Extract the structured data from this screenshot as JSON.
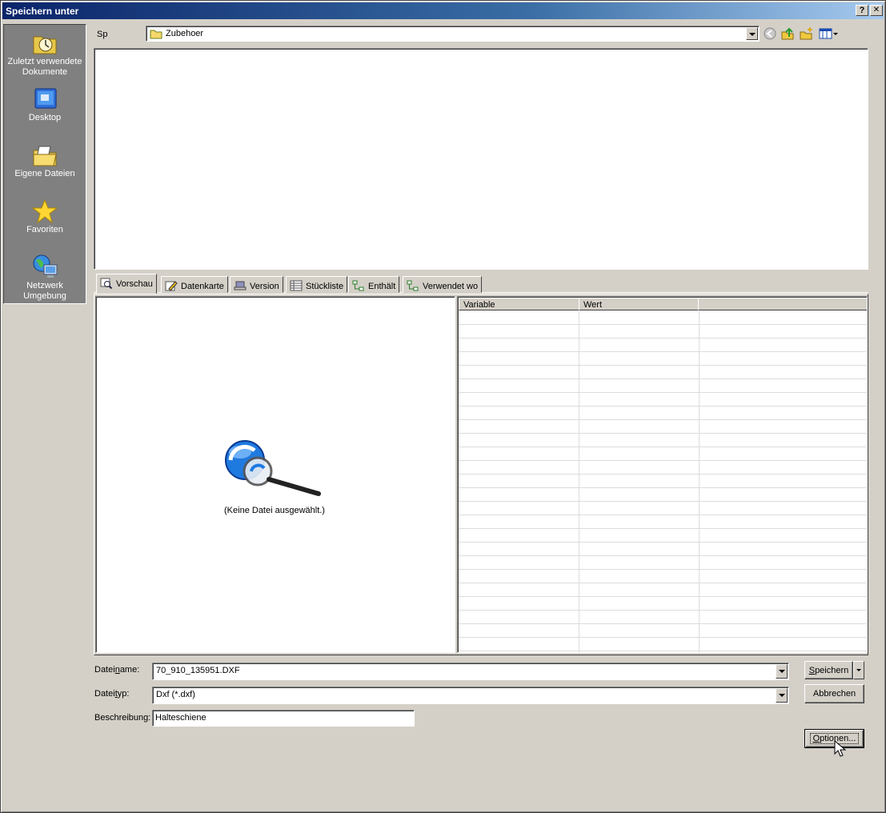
{
  "window": {
    "title": "Speichern unter",
    "help_label": "?",
    "close_label": "✕"
  },
  "places": [
    {
      "label": "Zuletzt verwendete Dokumente",
      "icon": "recent-documents-icon"
    },
    {
      "label": "Desktop",
      "icon": "desktop-icon"
    },
    {
      "label": "Eigene Dateien",
      "icon": "my-documents-icon"
    },
    {
      "label": "Favoriten",
      "icon": "favorites-star-icon"
    },
    {
      "label": "Netzwerk Umgebung",
      "icon": "network-neighborhood-icon"
    }
  ],
  "lookin": {
    "label": "Sp",
    "value": "Zubehoer",
    "folder_color": "#f5d86a"
  },
  "toolbar": {
    "icons": [
      "back-icon",
      "up-folder-icon",
      "new-folder-icon",
      "view-menu-icon"
    ]
  },
  "tabs": [
    {
      "label": "Vorschau",
      "icon": "preview-icon",
      "active": true
    },
    {
      "label": "Datenkarte",
      "icon": "datacard-icon",
      "active": false
    },
    {
      "label": "Version",
      "icon": "version-icon",
      "active": false
    },
    {
      "label": "Stückliste",
      "icon": "bom-list-icon",
      "active": false
    },
    {
      "label": "Enthält",
      "icon": "contains-icon",
      "active": false
    },
    {
      "label": "Verwendet wo",
      "icon": "where-used-icon",
      "active": false
    }
  ],
  "preview": {
    "message": "(Keine Datei ausgewählt.)"
  },
  "properties": {
    "columns": [
      "Variable",
      "Wert",
      ""
    ]
  },
  "form": {
    "filename_label_pre": "Datei",
    "filename_label_u": "n",
    "filename_label_post": "ame:",
    "filename_value": "70_910_135951.DXF",
    "filetype_label_pre": "Datei",
    "filetype_label_u": "t",
    "filetype_label_post": "yp:",
    "filetype_value": "Dxf (*.dxf)",
    "description_label": "Beschreibung:",
    "description_value": "Halteschiene"
  },
  "buttons": {
    "save_u": "S",
    "save_rest": "peichern",
    "cancel": "Abbrechen",
    "options_u": "O",
    "options_rest": "ptionen..."
  }
}
